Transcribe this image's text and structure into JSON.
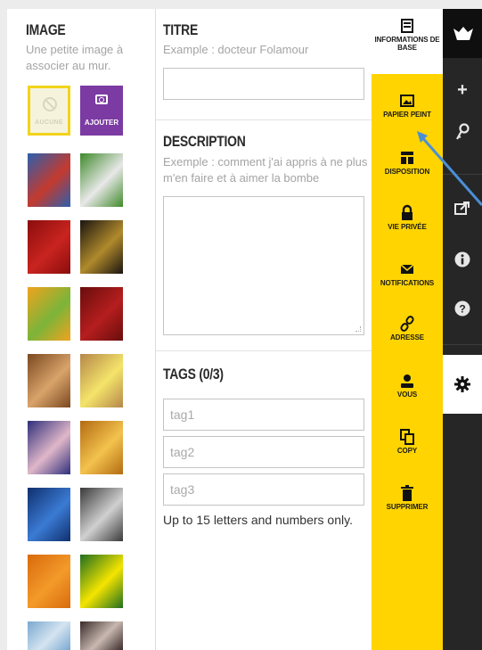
{
  "image_section": {
    "title": "IMAGE",
    "hint": "Une petite image à associer au mur.",
    "none_label": "AUCUNE",
    "add_label": "AJOUTER",
    "thumbnails": [
      {
        "name": "flags",
        "c1": "#2c5fae",
        "c2": "#c43a2e"
      },
      {
        "name": "soccer",
        "c1": "#3e8a2a",
        "c2": "#e8e8e8"
      },
      {
        "name": "rose",
        "c1": "#8a0d0d",
        "c2": "#c9241f"
      },
      {
        "name": "champagne",
        "c1": "#1a1410",
        "c2": "#b08a2c"
      },
      {
        "name": "origami",
        "c1": "#f0a31d",
        "c2": "#7bb43a"
      },
      {
        "name": "numbers",
        "c1": "#6a0d0d",
        "c2": "#b51e1e"
      },
      {
        "name": "notebook",
        "c1": "#7a4820",
        "c2": "#d9a36a"
      },
      {
        "name": "sticky-note",
        "c1": "#b5874a",
        "c2": "#f4e46a"
      },
      {
        "name": "birthday-cake",
        "c1": "#2e2e7a",
        "c2": "#e0b7c9"
      },
      {
        "name": "crowd",
        "c1": "#b36b12",
        "c2": "#f3c24d"
      },
      {
        "name": "globe",
        "c1": "#0f2f6e",
        "c2": "#3b7bd4"
      },
      {
        "name": "ball",
        "c1": "#3a3a3a",
        "c2": "#d0d0d0"
      },
      {
        "name": "megaphone",
        "c1": "#d96a0c",
        "c2": "#f39a2a"
      },
      {
        "name": "smiley",
        "c1": "#1f6f1f",
        "c2": "#f5e400"
      },
      {
        "name": "balance",
        "c1": "#7aa8d0",
        "c2": "#d4e4f0"
      },
      {
        "name": "wedding",
        "c1": "#3a2a2a",
        "c2": "#c8b8b0"
      }
    ]
  },
  "form": {
    "title_heading": "TITRE",
    "title_hint": "Example : docteur Folamour",
    "title_value": "",
    "description_heading": "DESCRIPTION",
    "description_hint": "Exemple : comment j'ai appris à ne plus m'en faire et à aimer la bombe",
    "description_value": "",
    "tags_heading": "TAGS (0/3)",
    "tags": [
      {
        "placeholder": "tag1"
      },
      {
        "placeholder": "tag2"
      },
      {
        "placeholder": "tag3"
      }
    ],
    "tags_help": "Up to 15 letters and numbers only."
  },
  "nav": {
    "items": [
      {
        "label": "INFORMATIONS DE BASE",
        "icon": "document-icon"
      },
      {
        "label": "PAPIER PEINT",
        "icon": "picture-icon"
      },
      {
        "label": "DISPOSITION",
        "icon": "layout-icon"
      },
      {
        "label": "VIE PRIVÉE",
        "icon": "lock-icon"
      },
      {
        "label": "NOTIFICATIONS",
        "icon": "envelope-icon"
      },
      {
        "label": "ADRESSE",
        "icon": "link-icon"
      },
      {
        "label": "VOUS",
        "icon": "user-icon"
      },
      {
        "label": "COPY",
        "icon": "copy-icon"
      },
      {
        "label": "SUPPRIMER",
        "icon": "trash-icon"
      }
    ],
    "colors": {
      "accent": "#ffd400",
      "rail": "#262626"
    }
  },
  "rail": {
    "buttons": [
      "logo-icon",
      "plus-icon",
      "key-icon",
      "share-icon",
      "info-icon",
      "help-icon",
      "gear-icon"
    ]
  }
}
